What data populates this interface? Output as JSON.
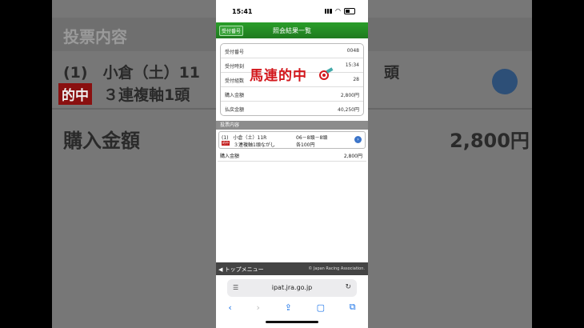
{
  "background": {
    "section_title": "投票内容",
    "line1_left": "(1)　小倉（土）11",
    "line1_right": "頭",
    "hit_badge": "的中",
    "line2": "３連複軸1頭",
    "amount_label": "購入金額",
    "amount_value": "2,800円"
  },
  "status_bar": {
    "time": "15:41"
  },
  "header": {
    "receipt_button": "受付番号",
    "title": "照会結果一覧"
  },
  "summary": {
    "rows": [
      {
        "label": "受付番号",
        "value": "0048"
      },
      {
        "label": "受付時刻",
        "value": "15:34"
      },
      {
        "label": "受付組数",
        "value": "28"
      },
      {
        "label": "購入金額",
        "value": "2,800円"
      },
      {
        "label": "払戻金額",
        "value": "40,250円"
      }
    ],
    "stamp": "馬連的中"
  },
  "bet_section": {
    "title": "投票内容",
    "line1": "(1)　小倉（土）11R",
    "hit_badge": "的中",
    "line2": "３連複軸1頭ながし",
    "horses": "06－8頭－8頭",
    "unit": "各100円"
  },
  "purchase": {
    "label": "購入金額",
    "value": "2,800円"
  },
  "footer": {
    "top_menu": "◀ トップメニュー",
    "copyright": "© Japan Racing Association."
  },
  "browser": {
    "url": "ipat.jra.go.jp"
  },
  "colors": {
    "header_green": "#2a9e2a",
    "stamp_red": "#d3181d",
    "link_blue": "#1a73e8"
  }
}
